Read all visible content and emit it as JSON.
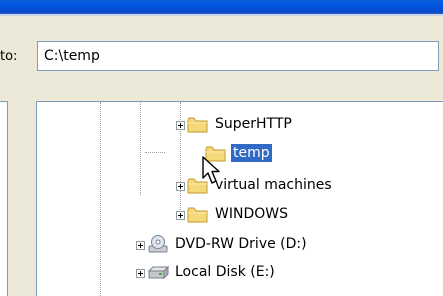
{
  "address": {
    "label": "to:",
    "value": "C:\\temp"
  },
  "tree": {
    "items": [
      {
        "label": "SuperHTTP",
        "icon": "folder-icon",
        "expandable": true,
        "selected": false
      },
      {
        "label": "temp",
        "icon": "folder-icon",
        "expandable": false,
        "selected": true
      },
      {
        "label": "virtual machines",
        "icon": "folder-icon",
        "expandable": true,
        "selected": false
      },
      {
        "label": "WINDOWS",
        "icon": "folder-icon",
        "expandable": true,
        "selected": false
      },
      {
        "label": "DVD-RW Drive (D:)",
        "icon": "dvd-drive-icon",
        "expandable": true,
        "selected": false
      },
      {
        "label": "Local Disk (E:)",
        "icon": "hard-disk-icon",
        "expandable": true,
        "selected": false
      }
    ]
  },
  "colors": {
    "selection": "#316ac5",
    "title_bar": "#0054e3",
    "folder": "#f5d87a"
  }
}
